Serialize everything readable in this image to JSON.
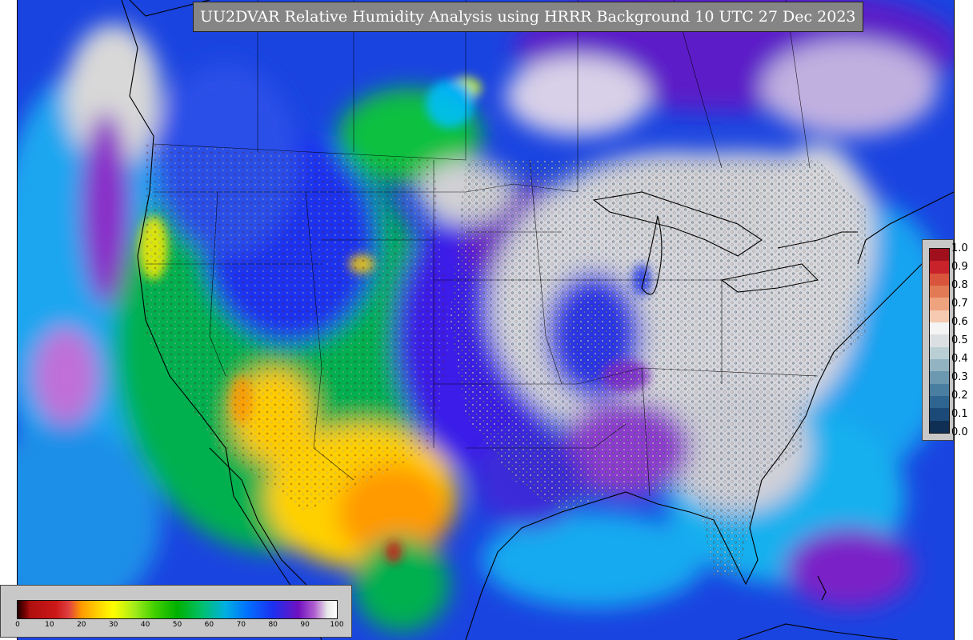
{
  "title": "UU2DVAR Relative Humidity Analysis using HRRR Background 10 UTC 27 Dec 2023",
  "obs_colorbar": {
    "ticks": [
      "1.0",
      "0.9",
      "0.8",
      "0.7",
      "0.6",
      "0.5",
      "0.4",
      "0.3",
      "0.2",
      "0.1",
      "0.0"
    ],
    "colors": [
      "#a0101c",
      "#c8222a",
      "#d8543c",
      "#e27a55",
      "#eea27e",
      "#f5cab0",
      "#f4f4f4",
      "#dcdfe1",
      "#b9cfd4",
      "#92b4c2",
      "#6c98b0",
      "#4a7ea0",
      "#2e6590",
      "#1c4a78",
      "#102f55"
    ]
  },
  "rh_legend": {
    "ticks": [
      "0",
      "10",
      "20",
      "30",
      "40",
      "50",
      "60",
      "70",
      "80",
      "90",
      "100"
    ],
    "stops": [
      [
        "#200000",
        0
      ],
      [
        "#6a0000",
        2
      ],
      [
        "#b01010",
        4
      ],
      [
        "#cc1818",
        12
      ],
      [
        "#e04040",
        16
      ],
      [
        "#ff9a00",
        20
      ],
      [
        "#ffd000",
        25
      ],
      [
        "#ffff00",
        30
      ],
      [
        "#9dea1a",
        37
      ],
      [
        "#40d000",
        43
      ],
      [
        "#00b000",
        50
      ],
      [
        "#00c070",
        58
      ],
      [
        "#00b0e0",
        65
      ],
      [
        "#0070ff",
        72
      ],
      [
        "#1d30f0",
        80
      ],
      [
        "#7010c0",
        88
      ],
      [
        "#b060d0",
        93
      ],
      [
        "#e8e8e8",
        97
      ],
      [
        "#ffffff",
        100
      ]
    ]
  }
}
